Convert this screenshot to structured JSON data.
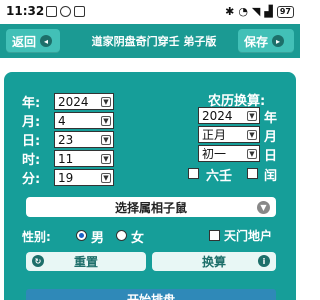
{
  "status_bar": {
    "time": "11:32",
    "battery": "97"
  },
  "header": {
    "back_label": "返回",
    "title": "道家阴盘奇门穿壬 弟子版",
    "save_label": "保存"
  },
  "solar": {
    "year_label": "年:",
    "year_value": "2024",
    "month_label": "月:",
    "month_value": "4",
    "day_label": "日:",
    "day_value": "23",
    "hour_label": "时:",
    "hour_value": "11",
    "minute_label": "分:",
    "minute_value": "19"
  },
  "lunar": {
    "title": "农历换算:",
    "year_value": "2024",
    "year_unit": "年",
    "month_value": "正月",
    "month_unit": "月",
    "day_value": "初一",
    "day_unit": "日",
    "liuren_label": "六壬",
    "liuren_checked": false,
    "leap_label": "闰",
    "leap_checked": false
  },
  "zodiac_select": "选择属相子鼠",
  "gender": {
    "label": "性别:",
    "male": "男",
    "female": "女",
    "selected": "男"
  },
  "tiandi_label": "天门地户",
  "buttons": {
    "reset": "重置",
    "convert": "换算",
    "start": "开始排盘"
  },
  "colors": {
    "header": "#1b9a93",
    "panel": "#169e99",
    "button_accent": "#42c0b7",
    "start": "#2f89b8"
  }
}
